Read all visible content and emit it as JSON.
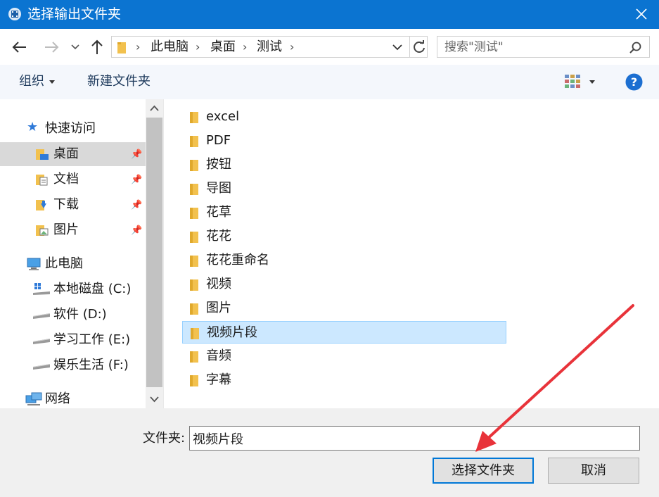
{
  "window": {
    "title": "选择输出文件夹"
  },
  "address": {
    "crumbs": [
      "此电脑",
      "桌面",
      "测试"
    ],
    "search_placeholder": "搜索\"测试\""
  },
  "toolbar": {
    "organize": "组织",
    "new_folder": "新建文件夹"
  },
  "nav": {
    "quick_access": "快速访问",
    "desktop": "桌面",
    "documents": "文档",
    "downloads": "下载",
    "pictures": "图片",
    "this_pc": "此电脑",
    "drive_c": "本地磁盘 (C:)",
    "drive_d": "软件 (D:)",
    "drive_e": "学习工作 (E:)",
    "drive_f": "娱乐生活 (F:)",
    "network": "网络",
    "selected": "桌面"
  },
  "files": [
    "excel",
    "PDF",
    "按钮",
    "导图",
    "花草",
    "花花",
    "花花重命名",
    "视频",
    "图片",
    "视频片段",
    "音频",
    "字幕"
  ],
  "selected_file": "视频片段",
  "footer": {
    "folder_label": "文件夹:",
    "folder_value": "视频片段",
    "select_button": "选择文件夹",
    "cancel_button": "取消"
  },
  "colors": {
    "titlebar": "#0b74d1",
    "selection": "#cce8ff",
    "annotation_arrow": "#e8333a"
  },
  "icons": {
    "app": "film-icon",
    "folder": "folder-icon",
    "help": "help-icon"
  }
}
